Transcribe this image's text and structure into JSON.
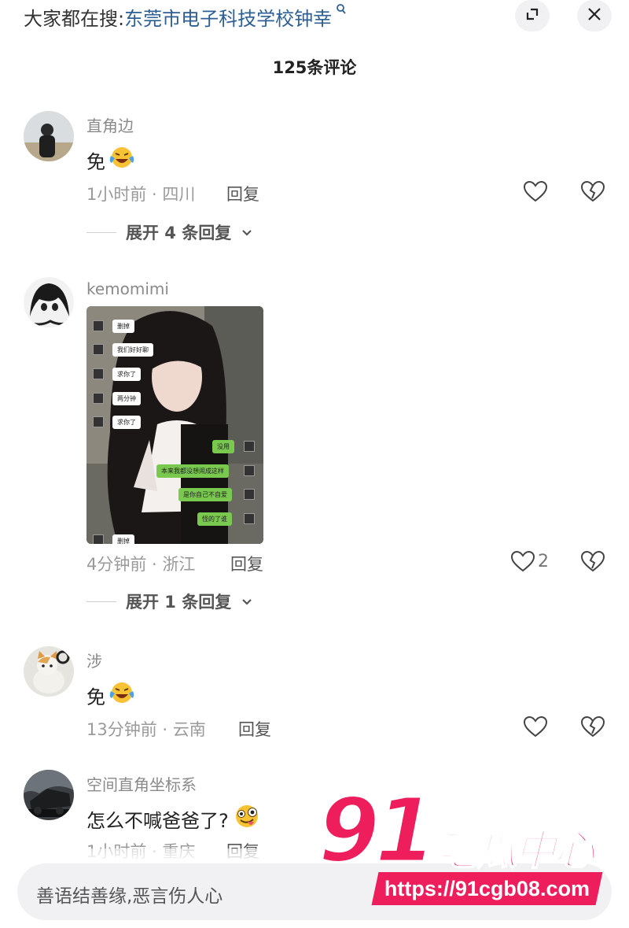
{
  "header": {
    "search_prefix": "大家都在搜:",
    "search_keyword": "东莞市电子科技学校钟幸",
    "search_icon": "search-icon",
    "expand_icon": "expand-icon",
    "close_icon": "close-icon"
  },
  "comment_count": "125条评论",
  "comments": [
    {
      "username": "直角边",
      "text": "免",
      "emoji": "laughing-crying-emoji",
      "meta": "1小时前 · 四川",
      "reply_label": "回复",
      "like_count": "",
      "expand_label": "展开 4 条回复"
    },
    {
      "username": "kemomimi",
      "text": "",
      "meta": "4分钟前 · 浙江",
      "reply_label": "回复",
      "like_count": "2",
      "expand_label": "展开 1 条回复",
      "image_chat": {
        "left": [
          "删掉",
          "我们好好聊",
          "求你了",
          "两分钟",
          "求你了",
          "删掉"
        ],
        "right": [
          "没用",
          "本来我都没想闹成这样",
          "是你自己不自爱",
          "怪的了谁"
        ]
      }
    },
    {
      "username": "涉",
      "text": "免",
      "emoji": "laughing-crying-emoji",
      "meta": "13分钟前 · 云南",
      "reply_label": "回复",
      "like_count": ""
    },
    {
      "username": "空间直角坐标系",
      "text": "怎么不喊爸爸了?",
      "emoji": "silly-face-emoji",
      "meta": "1小时前 · 重庆",
      "reply_label": "回复",
      "like_count": ""
    }
  ],
  "input": {
    "placeholder": "善语结善缘,恶言伤人心"
  },
  "watermark": {
    "number": "91",
    "text": "吃瓜中心",
    "url": "https://91cgb08.com"
  },
  "colors": {
    "keyword": "#2d5f94",
    "watermark": "#ee1e5c",
    "chat_green": "#7ac94f"
  }
}
